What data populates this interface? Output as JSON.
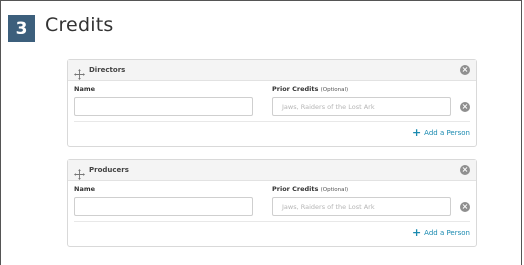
{
  "step": {
    "number": "3",
    "title": "Credits"
  },
  "sections": [
    {
      "title": "Directors",
      "name_label": "Name",
      "credits_label": "Prior Credits",
      "credits_optional": "(Optional)",
      "name_value": "",
      "credits_placeholder": "Jaws, Raiders of the Lost Ark",
      "add_label": "Add a Person"
    },
    {
      "title": "Producers",
      "name_label": "Name",
      "credits_label": "Prior Credits",
      "credits_optional": "(Optional)",
      "name_value": "",
      "credits_placeholder": "Jaws, Raiders of the Lost Ark",
      "add_label": "Add a Person"
    }
  ],
  "colors": {
    "badge": "#3c5f7c",
    "link": "#1a8ab0",
    "close_icon": "#8f8f8f"
  },
  "icons": {
    "drag": "move-icon",
    "remove": "close-circle-icon",
    "add": "plus-icon"
  }
}
